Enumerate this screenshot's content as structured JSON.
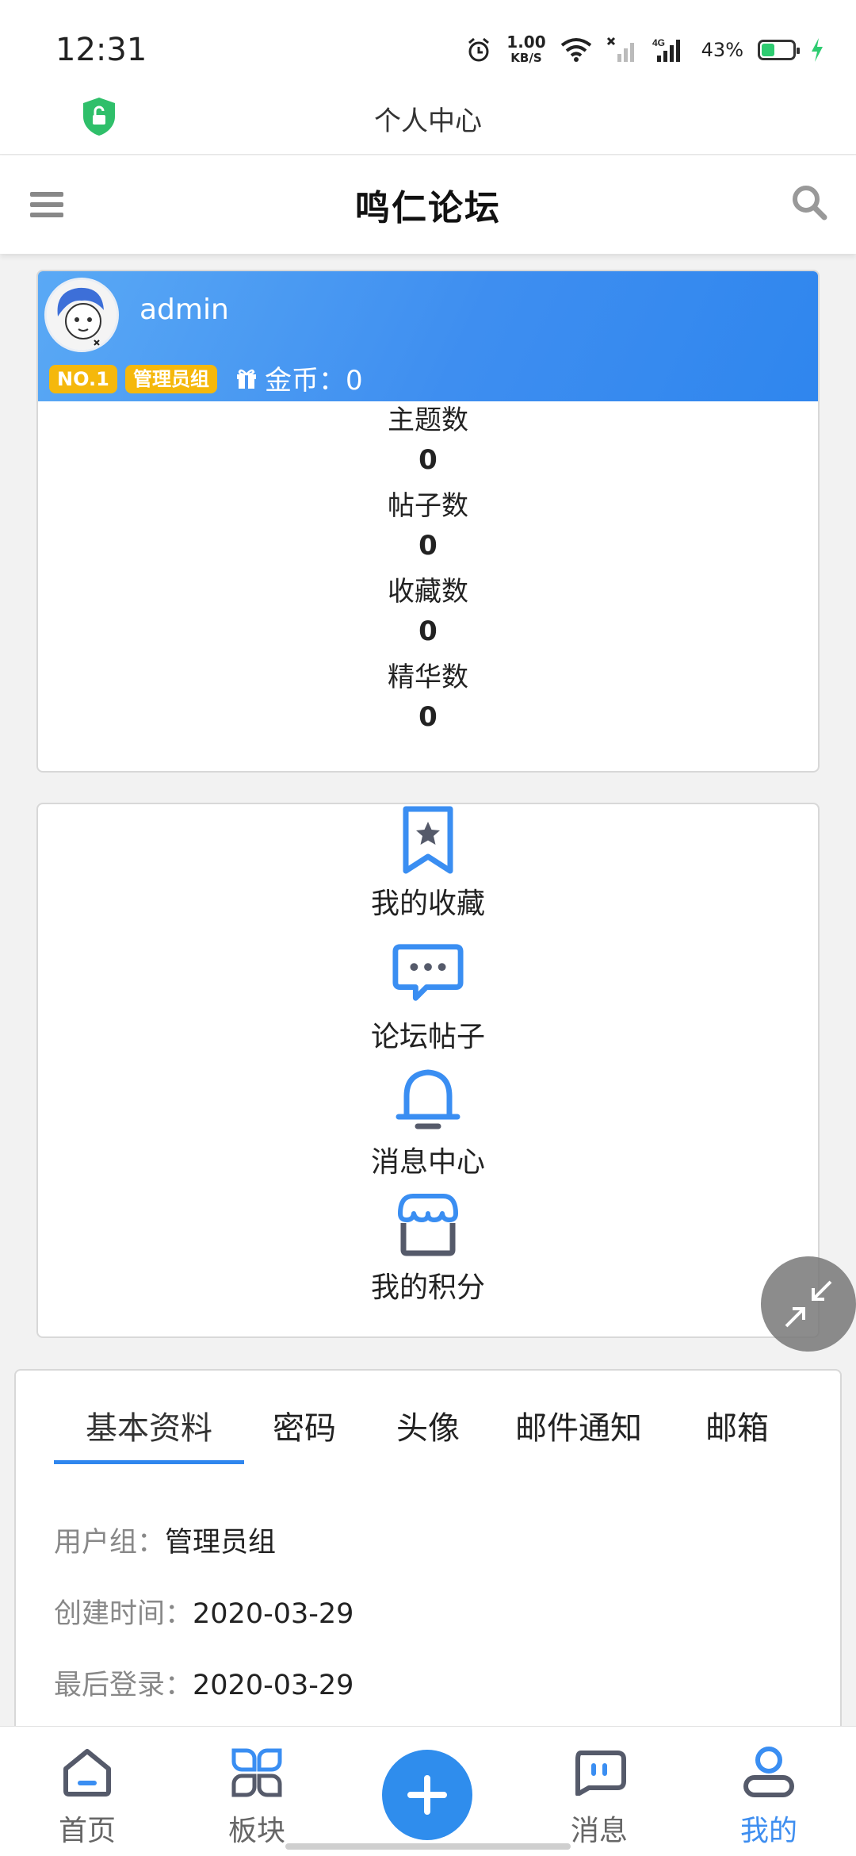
{
  "status_bar": {
    "time": "12:31",
    "speed_value": "1.00",
    "speed_unit": "KB/S",
    "network": "4G",
    "battery_percent": "43%",
    "battery_level": 0.43
  },
  "titlebar": {
    "title": "个人中心",
    "shield_icon": "shield-unlock-icon"
  },
  "forum_header": {
    "title": "鸣仁论坛",
    "left_icon": "hamburger-menu-icon",
    "right_icon": "search-icon"
  },
  "profile": {
    "username": "admin",
    "rank_badge": "NO.1",
    "group_badge": "管理员组",
    "coins_label": "金币：0",
    "stats": [
      {
        "label": "主题数",
        "value": "0"
      },
      {
        "label": "帖子数",
        "value": "0"
      },
      {
        "label": "收藏数",
        "value": "0"
      },
      {
        "label": "精华数",
        "value": "0"
      }
    ]
  },
  "menu": {
    "items": [
      {
        "label": "我的收藏",
        "icon": "bookmark-star-icon"
      },
      {
        "label": "论坛帖子",
        "icon": "chat-bubble-icon"
      },
      {
        "label": "消息中心",
        "icon": "bell-icon"
      },
      {
        "label": "我的积分",
        "icon": "shop-icon"
      }
    ]
  },
  "info": {
    "tabs": [
      "基本资料",
      "密码",
      "头像",
      "邮件通知",
      "邮箱"
    ],
    "active_tab": "基本资料",
    "rows": [
      {
        "label": "用户组：",
        "value": "管理员组"
      },
      {
        "label": "创建时间：",
        "value": "2020-03-29"
      },
      {
        "label": "最后登录：",
        "value": "2020-03-29"
      }
    ]
  },
  "bottom_nav": {
    "items": [
      {
        "label": "首页",
        "icon": "home-icon"
      },
      {
        "label": "板块",
        "icon": "grid-icon"
      },
      {
        "label": "消息",
        "icon": "message-icon"
      },
      {
        "label": "我的",
        "icon": "user-icon"
      }
    ],
    "center_icon": "plus-icon",
    "active": "我的"
  },
  "colors": {
    "accent": "#2f86ee",
    "badge": "#f5b80c",
    "floating_button": "#787878"
  }
}
